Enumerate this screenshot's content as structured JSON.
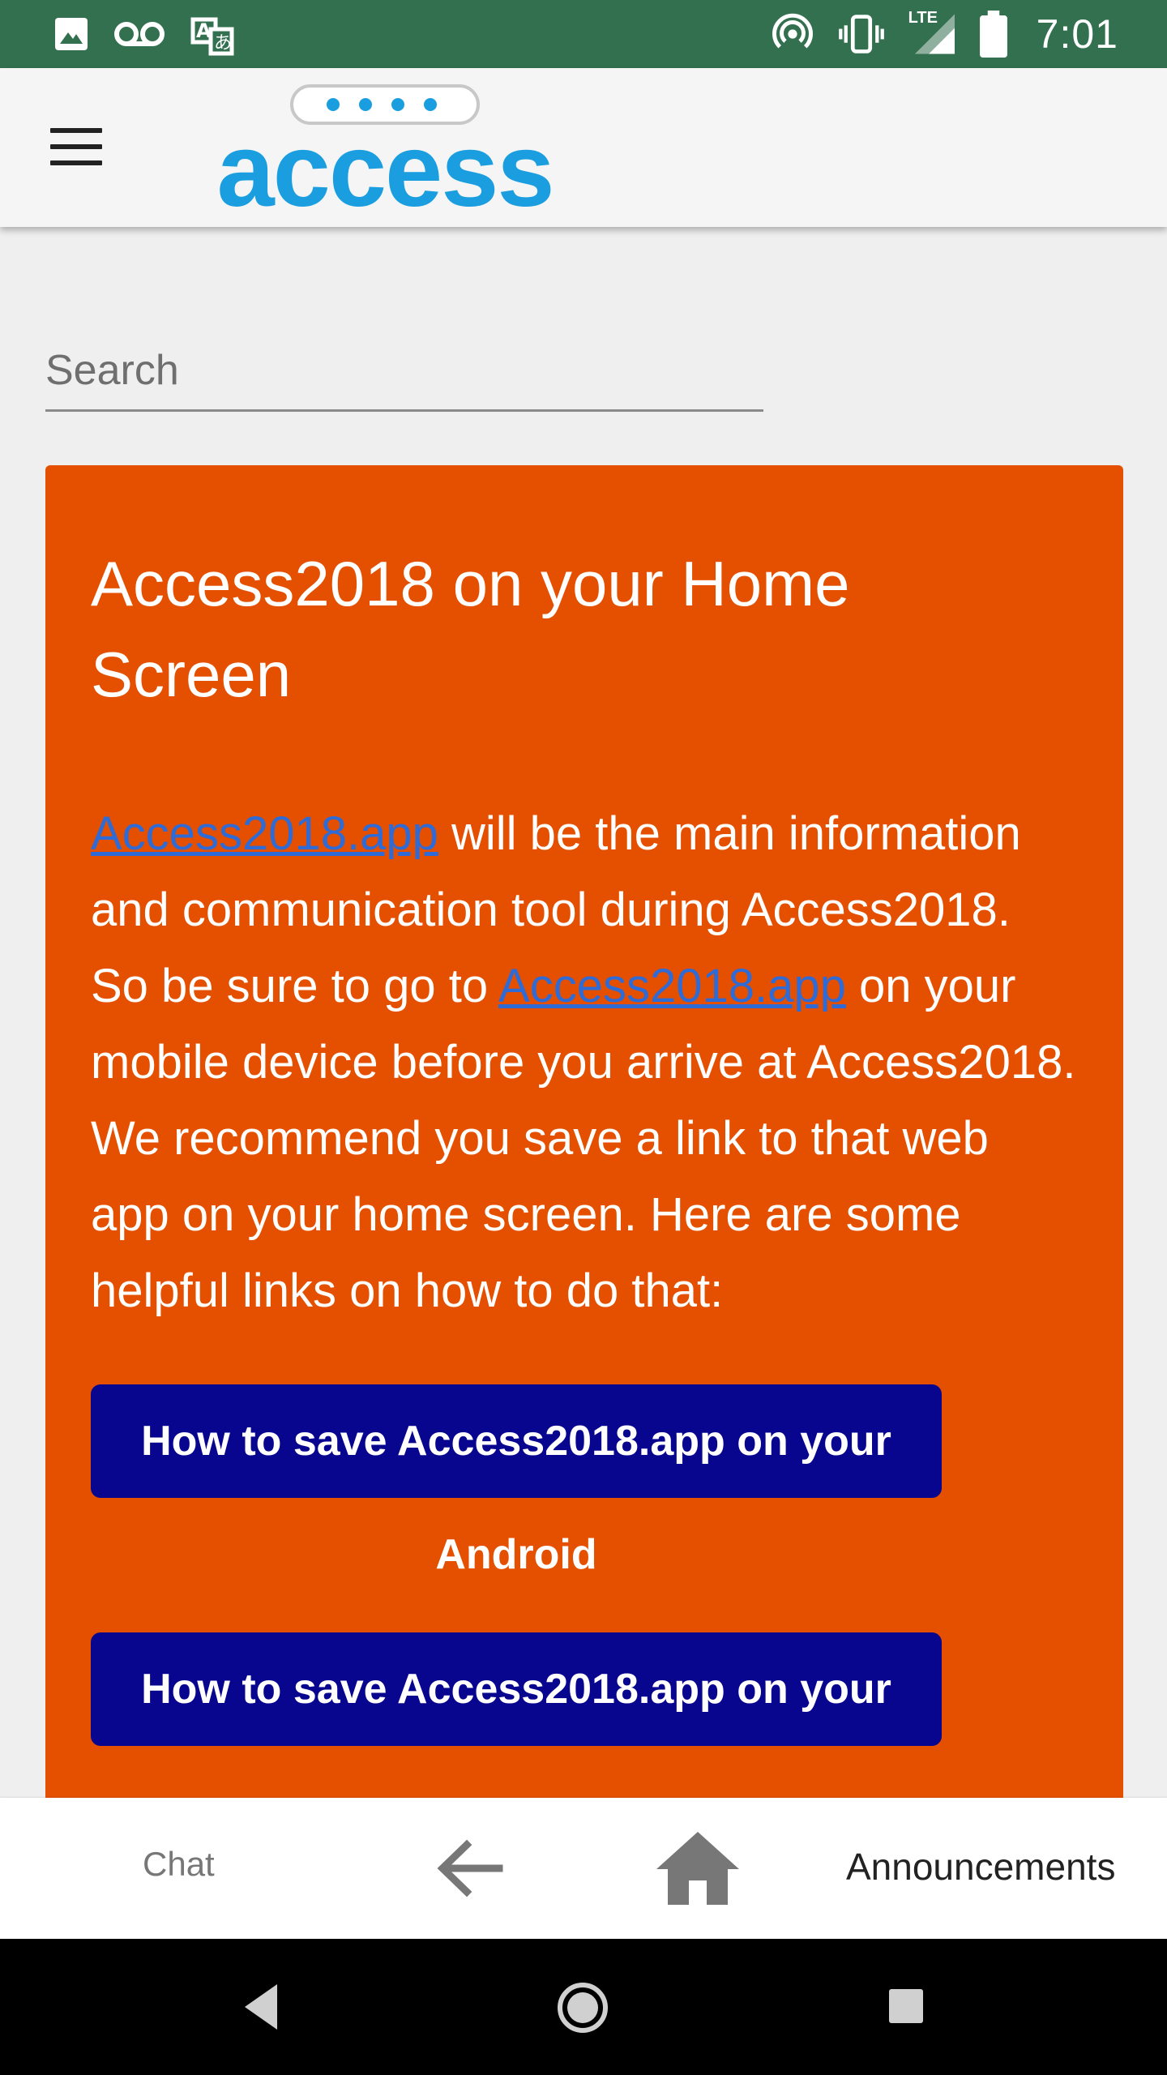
{
  "status_bar": {
    "time": "7:01",
    "network_label": "LTE",
    "icons": [
      "image-icon",
      "voicemail-icon",
      "translate-icon",
      "hotspot-icon",
      "vibrate-icon",
      "signal-icon",
      "battery-icon"
    ]
  },
  "header": {
    "logo_text": "access",
    "menu_icon": "hamburger-icon"
  },
  "search": {
    "placeholder": "Search",
    "value": ""
  },
  "card": {
    "title": "Access2018 on your Home Screen",
    "link_text": "Access2018.app",
    "body_part1": " will be the main information and communication tool during Access2018. So be sure to go to ",
    "body_part2": " on your mobile device before you arrive at Access2018. We recommend you save a link to that web app on your home screen. Here are some helpful links on how to do that:",
    "buttons": [
      {
        "label": "How to save Access2018.app on your",
        "sub": "Android"
      },
      {
        "label": "How to save Access2018.app on your",
        "sub": ""
      }
    ]
  },
  "bottom_nav": {
    "chat_label": "Chat",
    "announcements_label": "Announcements"
  },
  "colors": {
    "status_bar": "#33704f",
    "card": "#e55000",
    "button": "#08058f",
    "link": "#2e6bd6",
    "logo": "#1a9ee0"
  }
}
